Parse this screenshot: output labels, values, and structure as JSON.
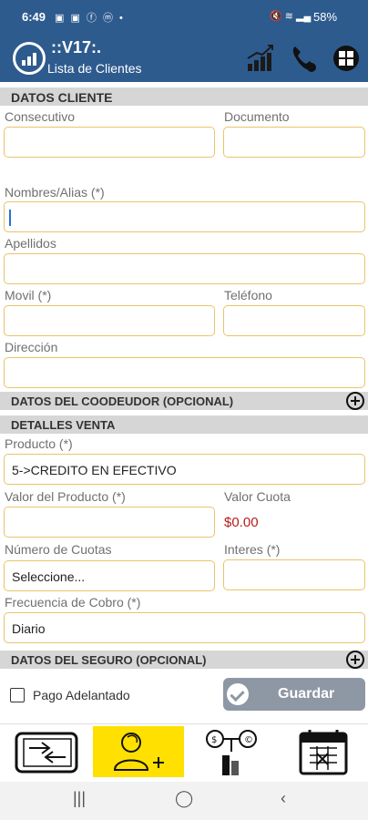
{
  "status_bar": {
    "time": "6:49",
    "battery": "58%",
    "left_icons": [
      "image-icon",
      "image-icon",
      "facebook-icon",
      "messenger-icon",
      "dot-icon"
    ],
    "right_icons": [
      "mute-icon",
      "wifi-icon",
      "signal-icon"
    ]
  },
  "app_bar": {
    "version": "::V17:.",
    "subtitle": "Lista de Clientes",
    "actions": [
      "chart-icon",
      "phone-icon",
      "windows-icon"
    ]
  },
  "datos_cliente": {
    "header": "DATOS CLIENTE",
    "consecutivo_label": "Consecutivo",
    "consecutivo_value": "",
    "documento_label": "Documento",
    "documento_value": "",
    "nombres_label": "Nombres/Alias (*)",
    "nombres_value": "",
    "apellidos_label": "Apellidos",
    "apellidos_value": "",
    "movil_label": "Movil (*)",
    "movil_value": "",
    "telefono_label": "Teléfono",
    "telefono_value": "",
    "direccion_label": "Dirección",
    "direccion_value": ""
  },
  "codeudor": {
    "header": "DATOS DEL COODEUDOR (OPCIONAL)"
  },
  "detalles_venta": {
    "header": "DETALLES VENTA",
    "producto_label": "Producto (*)",
    "producto_value": "5->CREDITO EN EFECTIVO",
    "valor_producto_label": "Valor del Producto (*)",
    "valor_producto_value": "",
    "valor_cuota_label": "Valor Cuota",
    "valor_cuota_value": "$0.00",
    "num_cuotas_label": "Número de Cuotas",
    "num_cuotas_value": "Seleccione...",
    "interes_label": "Interes (*)",
    "interes_value": "",
    "frecuencia_label": "Frecuencia de Cobro (*)",
    "frecuencia_value": "Diario"
  },
  "seguro": {
    "header": "DATOS DEL SEGURO (OPCIONAL)"
  },
  "footer_actions": {
    "pago_adelantado_label": "Pago Adelantado",
    "pago_adelantado_checked": false,
    "guardar_label": "Guardar"
  },
  "bottom_nav": [
    "transfer-icon",
    "add-client-icon",
    "payments-icon",
    "calendar-icon"
  ],
  "colors": {
    "brand": "#2e5b8e",
    "field_border": "#e9c46a",
    "active_nav": "#ffe000",
    "cuota": "#b71c1c",
    "save_button": "#8e98a4"
  }
}
